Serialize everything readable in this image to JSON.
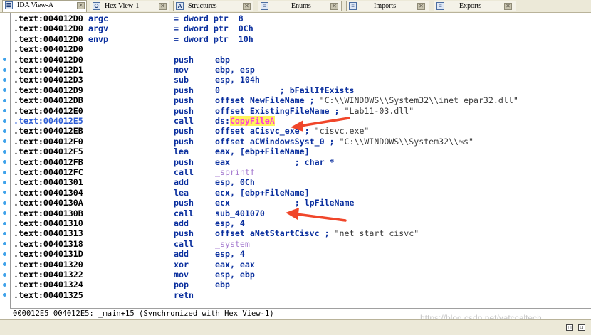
{
  "tabs": [
    {
      "label": "IDA View-A",
      "icon": "ida-view-icon",
      "active": true
    },
    {
      "label": "Hex View-1",
      "icon": "hex-view-icon",
      "active": false
    },
    {
      "label": "Structures",
      "icon": "structures-icon",
      "active": false
    },
    {
      "label": "Enums",
      "icon": "enums-icon",
      "active": false
    },
    {
      "label": "Imports",
      "icon": "imports-icon",
      "active": false
    },
    {
      "label": "Exports",
      "icon": "exports-icon",
      "active": false
    }
  ],
  "code": [
    {
      "addr": ".text:004012D0",
      "name": "argc",
      "mnem": "= dword ptr  8"
    },
    {
      "addr": ".text:004012D0",
      "name": "argv",
      "mnem": "= dword ptr  0Ch"
    },
    {
      "addr": ".text:004012D0",
      "name": "envp",
      "mnem": "= dword ptr  10h"
    },
    {
      "addr": ".text:004012D0"
    },
    {
      "addr": ".text:004012D0",
      "mnem": "push",
      "op": "ebp"
    },
    {
      "addr": ".text:004012D1",
      "mnem": "mov",
      "op": "ebp, esp"
    },
    {
      "addr": ".text:004012D3",
      "mnem": "sub",
      "op": "esp, 104h"
    },
    {
      "addr": ".text:004012D9",
      "mnem": "push",
      "op": "0",
      "comment": "            ; bFailIfExists"
    },
    {
      "addr": ".text:004012DB",
      "mnem": "push",
      "op": "offset NewFileName",
      "comment": " ; ",
      "str": "\"C:\\\\WINDOWS\\\\System32\\\\inet_epar32.dll\""
    },
    {
      "addr": ".text:004012E0",
      "mnem": "push",
      "op": "offset ExistingFileName",
      "comment": " ; ",
      "str": "\"Lab11-03.dll\""
    },
    {
      "addr": ".text:004012E5",
      "mnem": "call",
      "op": "ds:",
      "import": "CopyFileA",
      "selected": true
    },
    {
      "addr": ".text:004012EB",
      "mnem": "push",
      "op": "offset aCisvc_exe",
      "comment": " ; ",
      "str": "\"cisvc.exe\""
    },
    {
      "addr": ".text:004012F0",
      "mnem": "push",
      "op": "offset aCWindowsSyst_0",
      "comment": " ; ",
      "str": "\"C:\\\\WINDOWS\\\\System32\\\\%s\""
    },
    {
      "addr": ".text:004012F5",
      "mnem": "lea",
      "op": "eax, [ebp+FileName]"
    },
    {
      "addr": ".text:004012FB",
      "mnem": "push",
      "op": "eax",
      "comment": "             ; char *"
    },
    {
      "addr": ".text:004012FC",
      "mnem": "call",
      "func": "_sprintf"
    },
    {
      "addr": ".text:00401301",
      "mnem": "add",
      "op": "esp, 0Ch"
    },
    {
      "addr": ".text:00401304",
      "mnem": "lea",
      "op": "ecx, [ebp+FileName]"
    },
    {
      "addr": ".text:0040130A",
      "mnem": "push",
      "op": "ecx",
      "comment": "             ; lpFileName"
    },
    {
      "addr": ".text:0040130B",
      "mnem": "call",
      "op": "sub_401070"
    },
    {
      "addr": ".text:00401310",
      "mnem": "add",
      "op": "esp, 4"
    },
    {
      "addr": ".text:00401313",
      "mnem": "push",
      "op": "offset aNetStartCisvc",
      "comment": " ; ",
      "str": "\"net start cisvc\""
    },
    {
      "addr": ".text:00401318",
      "mnem": "call",
      "func": "_system"
    },
    {
      "addr": ".text:0040131D",
      "mnem": "add",
      "op": "esp, 4"
    },
    {
      "addr": ".text:00401320",
      "mnem": "xor",
      "op": "eax, eax"
    },
    {
      "addr": ".text:00401322",
      "mnem": "mov",
      "op": "esp, ebp"
    },
    {
      "addr": ".text:00401324",
      "mnem": "pop",
      "op": "ebp"
    },
    {
      "addr": ".text:00401325",
      "mnem": "retn"
    }
  ],
  "status": {
    "text": "000012E5 004012E5: _main+15 (Synchronized with Hex View-1)"
  },
  "watermark": "https://blog.csdn.net/yatccaltech",
  "colors": {
    "address": "#000000",
    "selected_address": "#2d5cd4",
    "mnemonic": "#0a2f9e",
    "import_highlight_bg": "#fff45c",
    "import_text": "#ff3ad8",
    "annotation_arrow": "#f0462a"
  }
}
